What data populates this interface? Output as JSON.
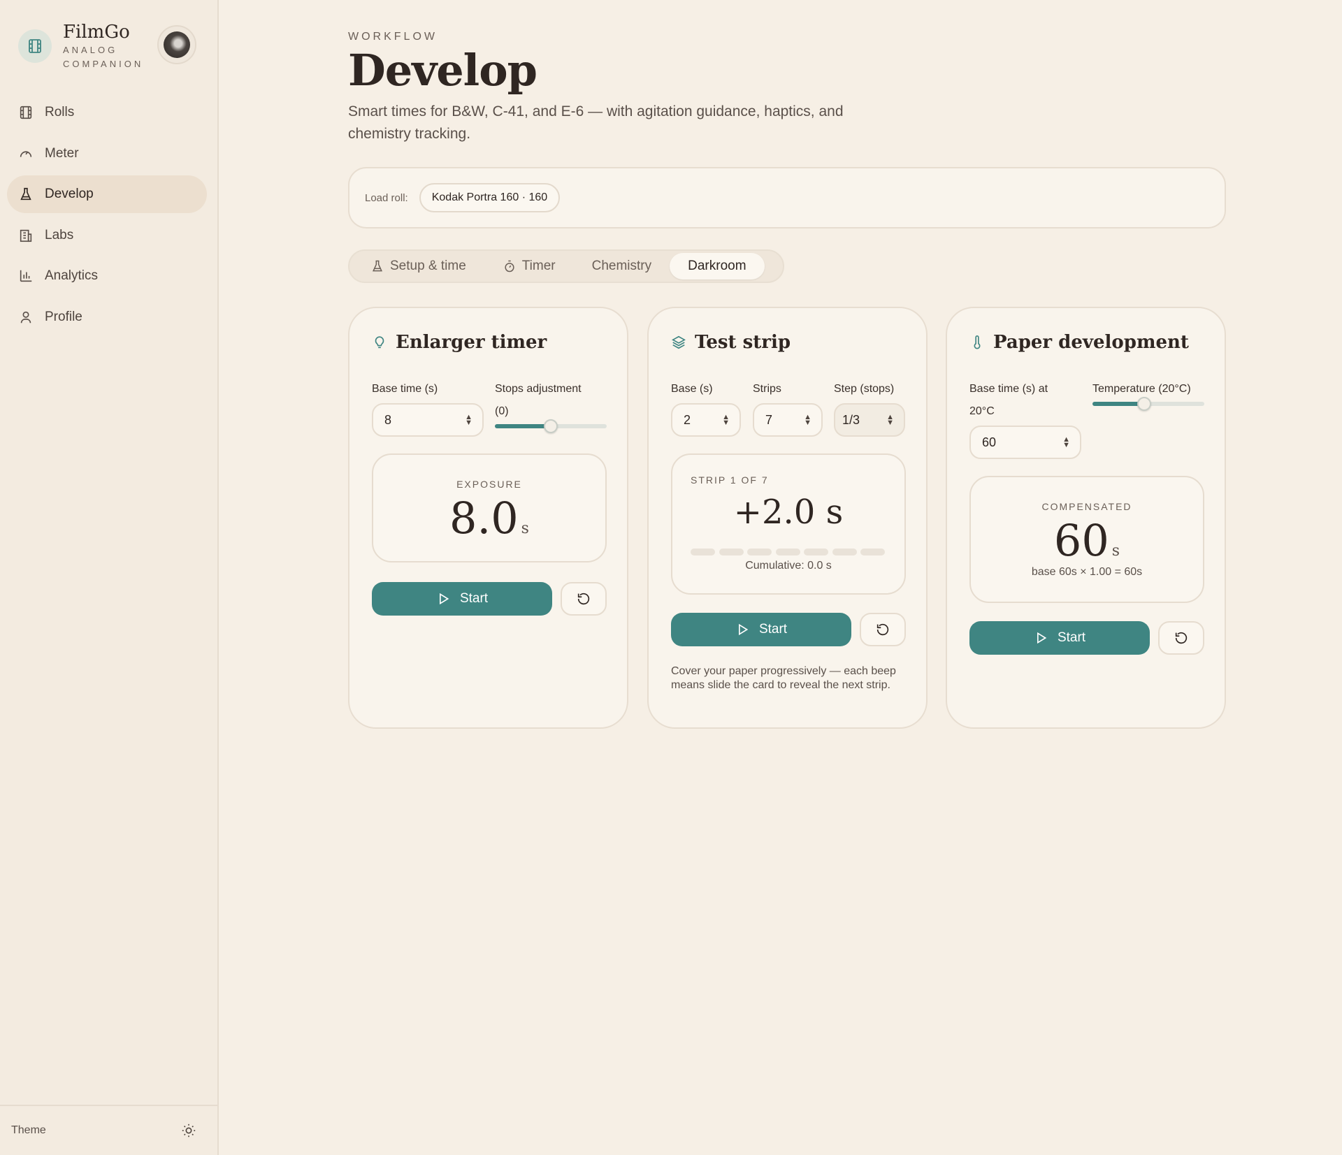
{
  "app": {
    "name": "FilmGo",
    "tagline": "ANALOG COMPANION"
  },
  "nav": {
    "items": [
      {
        "label": "Rolls",
        "icon": "film-icon"
      },
      {
        "label": "Meter",
        "icon": "gauge-icon"
      },
      {
        "label": "Develop",
        "icon": "flask-icon",
        "active": true
      },
      {
        "label": "Labs",
        "icon": "building-icon"
      },
      {
        "label": "Analytics",
        "icon": "bar-chart-icon"
      },
      {
        "label": "Profile",
        "icon": "user-icon"
      }
    ]
  },
  "footer": {
    "theme_label": "Theme",
    "theme_icon": "sun-icon"
  },
  "header": {
    "eyebrow": "WORKFLOW",
    "title": "Develop",
    "subtitle": "Smart times for B&W, C-41, and E-6 — with agitation guidance, haptics, and chemistry tracking."
  },
  "load_roll": {
    "label": "Load roll:",
    "value": "Kodak Portra 160 · 160"
  },
  "tabs": [
    {
      "label": "Setup & time",
      "icon": "flask-icon"
    },
    {
      "label": "Timer",
      "icon": "stopwatch-icon"
    },
    {
      "label": "Chemistry"
    },
    {
      "label": "Darkroom",
      "active": true
    }
  ],
  "enlarger": {
    "title": "Enlarger timer",
    "icon": "bulb-icon",
    "base_label": "Base time (s)",
    "base_value": "8",
    "stops_label": "Stops adjustment",
    "stops_value_text": "(0)",
    "stops_slider_fraction": 0.5,
    "readout_label": "EXPOSURE",
    "readout_value": "8.0",
    "readout_unit": "s",
    "start_label": "Start"
  },
  "test_strip": {
    "title": "Test strip",
    "icon": "layers-icon",
    "base_label": "Base (s)",
    "base_value": "2",
    "strips_label": "Strips",
    "strips_value": "7",
    "step_label": "Step (stops)",
    "step_value": "1/3",
    "strip_counter": "STRIP 1 OF 7",
    "strip_value": "+2.0 s",
    "strip_count": 7,
    "cumulative": "Cumulative: 0.0 s",
    "start_label": "Start",
    "hint": "Cover your paper progressively — each beep means slide the card to reveal the next strip."
  },
  "paper": {
    "title": "Paper development",
    "icon": "thermometer-icon",
    "base_label": "Base time (s) at 20°C",
    "base_value": "60",
    "temp_label": "Temperature (20°C)",
    "temp_slider_fraction": 0.46,
    "readout_label": "COMPENSATED",
    "readout_value": "60",
    "readout_unit": "s",
    "formula": "base 60s × 1.00 = 60s",
    "start_label": "Start"
  },
  "colors": {
    "accent": "#3f8582",
    "background": "#f6efe5",
    "card": "#f9f4ec"
  }
}
